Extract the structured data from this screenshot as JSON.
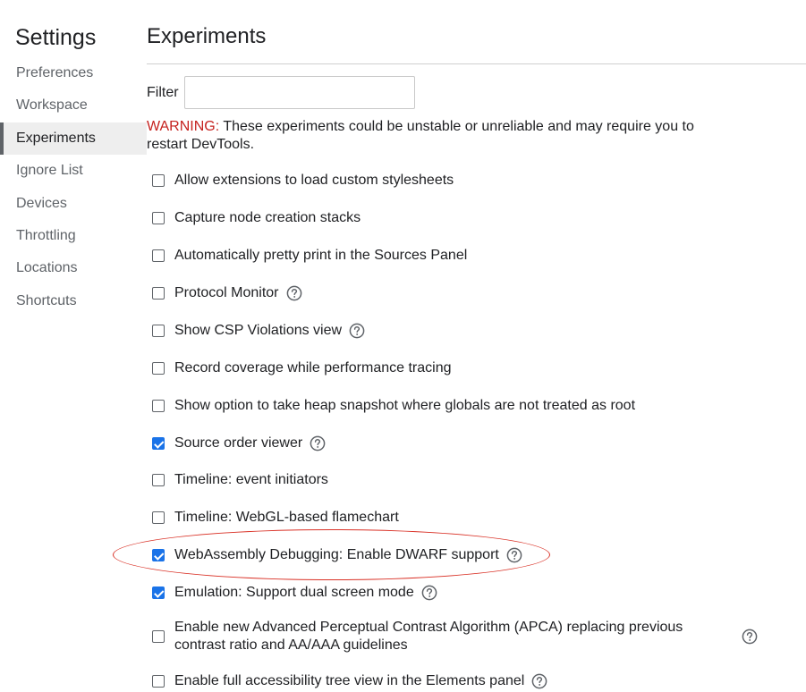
{
  "sidebar": {
    "title": "Settings",
    "items": [
      {
        "label": "Preferences",
        "active": false
      },
      {
        "label": "Workspace",
        "active": false
      },
      {
        "label": "Experiments",
        "active": true
      },
      {
        "label": "Ignore List",
        "active": false
      },
      {
        "label": "Devices",
        "active": false
      },
      {
        "label": "Throttling",
        "active": false
      },
      {
        "label": "Locations",
        "active": false
      },
      {
        "label": "Shortcuts",
        "active": false
      }
    ]
  },
  "main": {
    "title": "Experiments",
    "filter": {
      "label": "Filter",
      "value": "",
      "placeholder": ""
    },
    "warning": {
      "label": "WARNING:",
      "text": " These experiments could be unstable or unreliable and may require you to restart DevTools."
    },
    "experiments": [
      {
        "label": "Allow extensions to load custom stylesheets",
        "checked": false,
        "help": false
      },
      {
        "label": "Capture node creation stacks",
        "checked": false,
        "help": false
      },
      {
        "label": "Automatically pretty print in the Sources Panel",
        "checked": false,
        "help": false
      },
      {
        "label": "Protocol Monitor",
        "checked": false,
        "help": true
      },
      {
        "label": "Show CSP Violations view",
        "checked": false,
        "help": true
      },
      {
        "label": "Record coverage while performance tracing",
        "checked": false,
        "help": false
      },
      {
        "label": "Show option to take heap snapshot where globals are not treated as root",
        "checked": false,
        "help": false
      },
      {
        "label": "Source order viewer",
        "checked": true,
        "help": true
      },
      {
        "label": "Timeline: event initiators",
        "checked": false,
        "help": false
      },
      {
        "label": "Timeline: WebGL-based flamechart",
        "checked": false,
        "help": false
      },
      {
        "label": "WebAssembly Debugging: Enable DWARF support",
        "checked": true,
        "help": true
      },
      {
        "label": "Emulation: Support dual screen mode",
        "checked": true,
        "help": true
      },
      {
        "label": "Enable new Advanced Perceptual Contrast Algorithm (APCA) replacing previous contrast ratio and AA/AAA guidelines",
        "checked": false,
        "help": true
      },
      {
        "label": "Enable full accessibility tree view in the Elements panel",
        "checked": false,
        "help": true
      }
    ]
  },
  "colors": {
    "accent": "#1a73e8",
    "warning": "#c5221f",
    "annotation": "#d93025",
    "active_nav_bg": "#eeeeee"
  },
  "icons": {
    "help": "help-circle-icon"
  }
}
